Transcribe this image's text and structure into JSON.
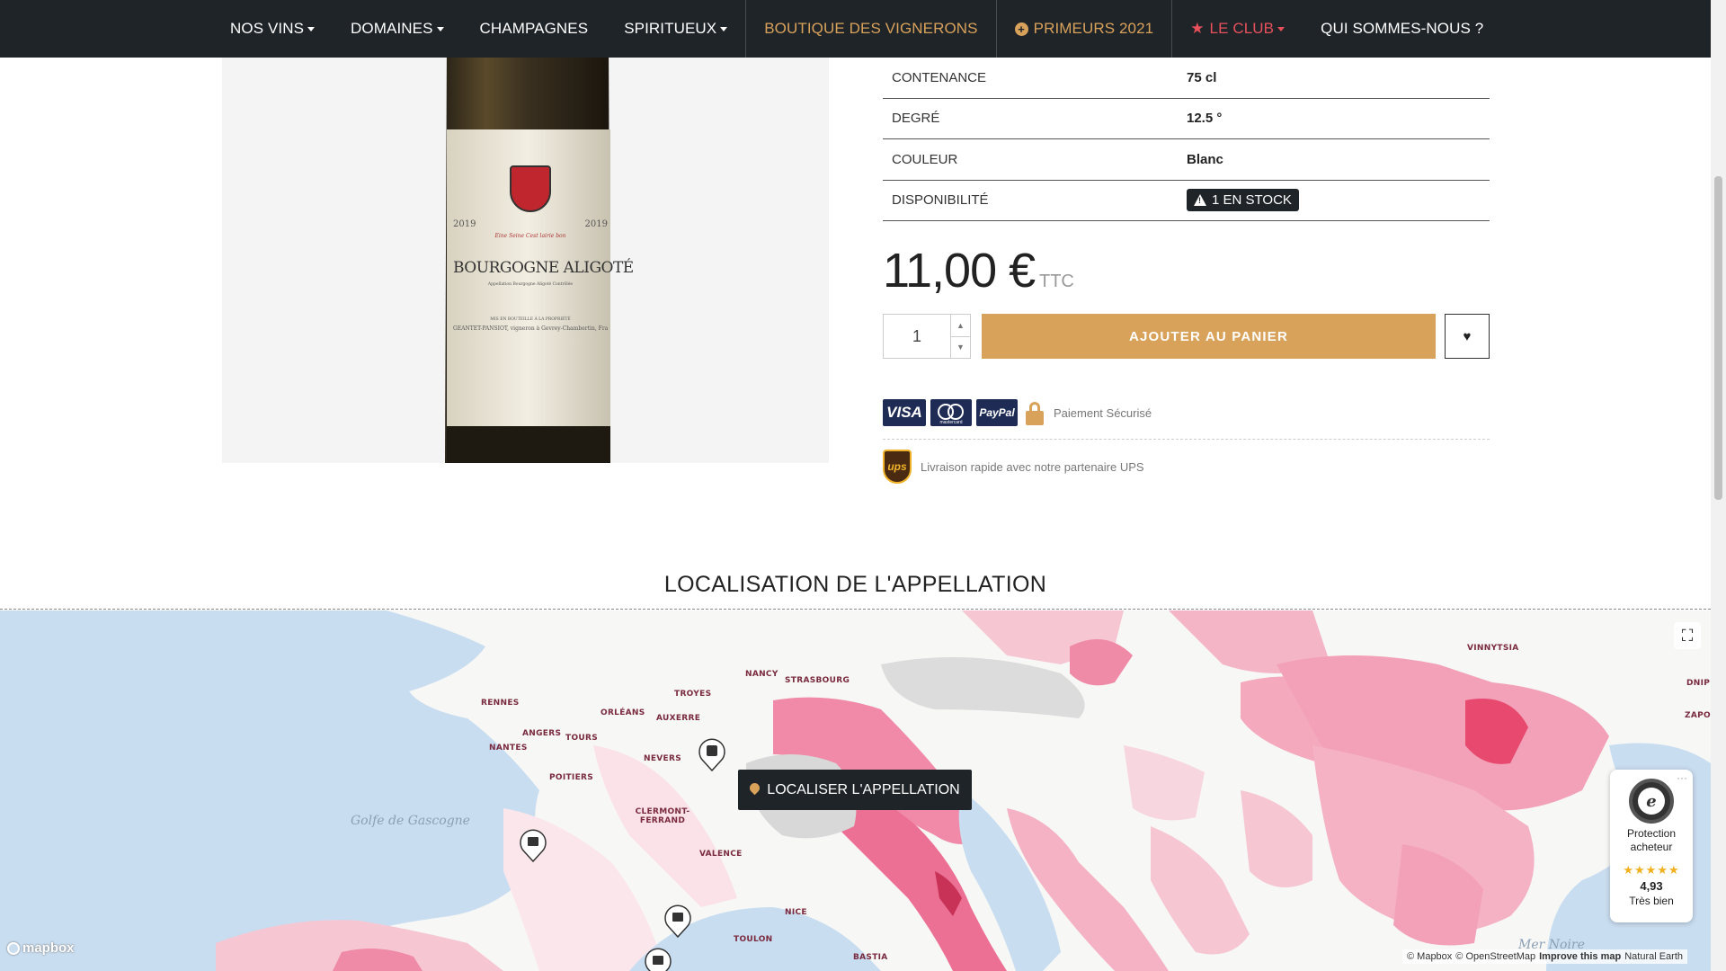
{
  "nav": {
    "items": [
      {
        "label": "NOS VINS",
        "caret": true
      },
      {
        "label": "DOMAINES",
        "caret": true
      },
      {
        "label": "CHAMPAGNES",
        "caret": false
      },
      {
        "label": "SPIRITUEUX",
        "caret": true
      },
      {
        "label": "BOUTIQUE DES VIGNERONS",
        "caret": false
      },
      {
        "label": "PRIMEURS 2021",
        "caret": false
      },
      {
        "label": "LE CLUB",
        "caret": true
      },
      {
        "label": "QUI SOMMES-NOUS ?",
        "caret": false
      }
    ]
  },
  "product": {
    "label_title": "BOURGOGNE ALIGOTÉ",
    "label_year": "2019",
    "label_motto": "Eine Seine Cest lairie bon",
    "label_appellation": "Appellation Bourgogne Aligoté Contrôlée",
    "label_bottled": "MIS EN BOUTEILLE À LA PROPRIÉTÉ",
    "label_producer": "GEANTET-PANSIOT, vigneron à Gevrey-Chambertin, France"
  },
  "specs": [
    {
      "key": "CONTENANCE",
      "value": "75 cl"
    },
    {
      "key": "DEGRÉ",
      "value": "12.5 °"
    },
    {
      "key": "COULEUR",
      "value": "Blanc"
    },
    {
      "key": "DISPONIBILITÉ",
      "value": "1 EN STOCK"
    }
  ],
  "price": {
    "amount": "11,00 €",
    "suffix": "TTC"
  },
  "cart": {
    "quantity": "1",
    "add_label": "AJOUTER AU PANIER"
  },
  "payment": {
    "visa": "VISA",
    "paypal": "PayPal",
    "mastercard": "mastercard",
    "secure_text": "Paiement Sécurisé"
  },
  "shipping": {
    "ups": "ups",
    "text": "Livraison rapide avec notre partenaire UPS"
  },
  "section": {
    "title": "LOCALISATION DE L'APPELLATION"
  },
  "map": {
    "locate_label": "LOCALISER L'APPELLATION",
    "cities": [
      "RENNES",
      "NANCY",
      "STRASBOURG",
      "TROYES",
      "ORLÉANS",
      "AUXERRE",
      "ANGERS",
      "TOURS",
      "NANTES",
      "NEVERS",
      "POITIERS",
      "CLERMONT-FERRAND",
      "VALENCE",
      "NICE",
      "TOULON",
      "BASTIA",
      "VINNYTSIA",
      "DNIP",
      "ZAPO"
    ],
    "sea_labels": [
      "Golfe de Gascogne",
      "Mer Noire"
    ],
    "logo": "mapbox",
    "attribution": [
      "© Mapbox",
      "© OpenStreetMap",
      "Improve this map",
      "Natural Earth"
    ]
  },
  "trusted": {
    "seal": "e",
    "label": "Protection acheteur",
    "stars": "★★★★★",
    "score": "4,93",
    "rating": "Très bien"
  },
  "colors": {
    "nav_bg": "#1f2428",
    "accent_gold": "#d9a25b",
    "club_red": "#e8505b",
    "map_pink": "#f08aa8"
  }
}
